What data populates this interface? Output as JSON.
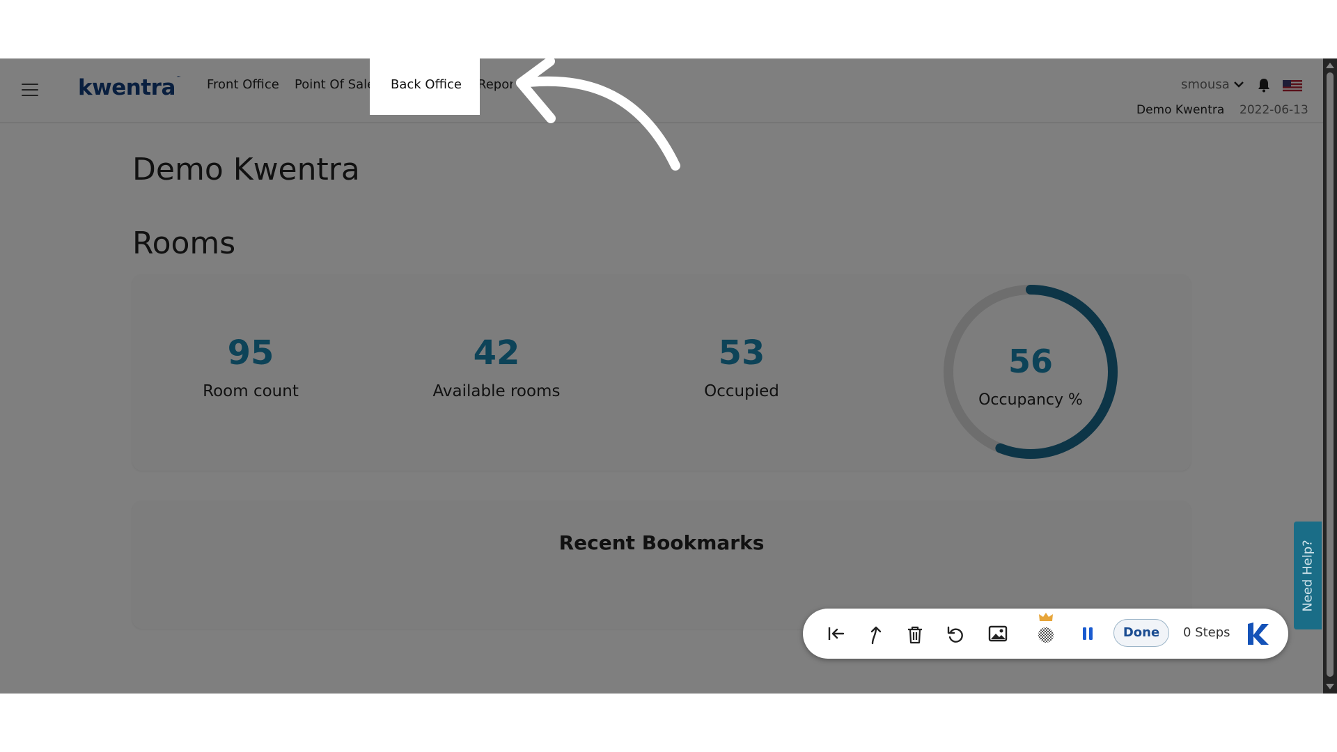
{
  "app": {
    "logo": "kwentra",
    "logo_tm": "™"
  },
  "nav": {
    "items": [
      {
        "label": "Front Office"
      },
      {
        "label": "Point Of Sale"
      },
      {
        "label": "Back Office"
      },
      {
        "label": "Reports"
      }
    ],
    "highlighted": "Back Office"
  },
  "header": {
    "username": "smousa",
    "property": "Demo Kwentra",
    "date": "2022-06-13",
    "flag_icon": "us-flag-icon"
  },
  "main": {
    "title": "Demo Kwentra",
    "section_title": "Rooms",
    "stats": [
      {
        "value": "95",
        "label": "Room count"
      },
      {
        "value": "42",
        "label": "Available rooms"
      },
      {
        "value": "53",
        "label": "Occupied"
      }
    ],
    "occupancy": {
      "value": "56",
      "label": "Occupancy %",
      "fraction": 0.56
    },
    "bookmarks_title": "Recent Bookmarks"
  },
  "help": {
    "label": "Need Help?"
  },
  "toolbar": {
    "icons": [
      "skip-to-start-icon",
      "branch-icon",
      "trash-icon",
      "undo-icon",
      "image-icon",
      "blur-premium-icon",
      "pause-icon"
    ],
    "done_label": "Done",
    "steps_label": "0 Steps"
  },
  "colors": {
    "accent": "#1b86b1",
    "logo": "#123f7f",
    "help_tab": "#1a6d87",
    "overlay": "rgba(0,0,0,0.5)"
  }
}
